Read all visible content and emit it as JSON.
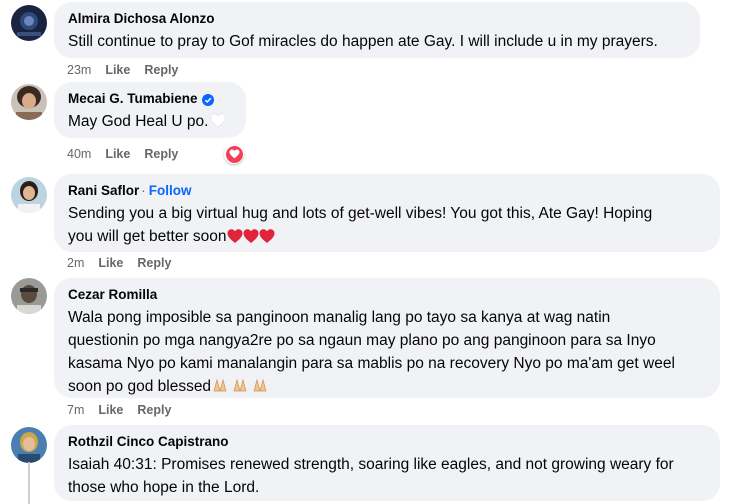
{
  "colors": {
    "bubble": "#f0f2f5",
    "meta_text": "#65676b",
    "follow_blue": "#0866ff",
    "verified_blue": "#0866ff",
    "love_react": "#f33e58"
  },
  "comments": [
    {
      "author": "Almira Dichosa Alonzo",
      "text": "Still continue to pray to Gof miracles do happen ate Gay. I will include u in my prayers.",
      "time": "23m",
      "like": "Like",
      "reply": "Reply"
    },
    {
      "author": "Mecai G. Tumabiene",
      "verified": true,
      "text": "May God Heal U po.",
      "emoji": "white-heart",
      "time": "40m",
      "like": "Like",
      "reply": "Reply",
      "reaction": "love-heart"
    },
    {
      "author": "Rani Saflor",
      "separator": "·",
      "follow": "Follow",
      "text_line1": "Sending you a big virtual hug and lots of get-well vibes! You got this, Ate Gay! Hoping",
      "text_line2": "you will get better soon",
      "emoji": "red-heart x3",
      "time": "2m",
      "like": "Like",
      "reply": "Reply"
    },
    {
      "author": "Cezar Romilla",
      "text_line1": "Wala pong imposible sa panginoon manalig lang po tayo sa kanya at wag natin",
      "text_line2": "questionin po mga nangya2re po sa ngaun may plano po ang panginoon para sa Inyo",
      "text_line3": "kasama Nyo po kami manalangin para sa mablis po na recovery Nyo po ma'am get weel",
      "text_line4": "soon po god blessed",
      "emoji": "folded-hands x3",
      "time": "7m",
      "like": "Like",
      "reply": "Reply"
    },
    {
      "author": "Rothzil Cinco Capistrano",
      "text_line1": "Isaiah 40:31: Promises renewed strength, soaring like eagles, and not growing weary for",
      "text_line2": "those who hope in the Lord."
    }
  ]
}
